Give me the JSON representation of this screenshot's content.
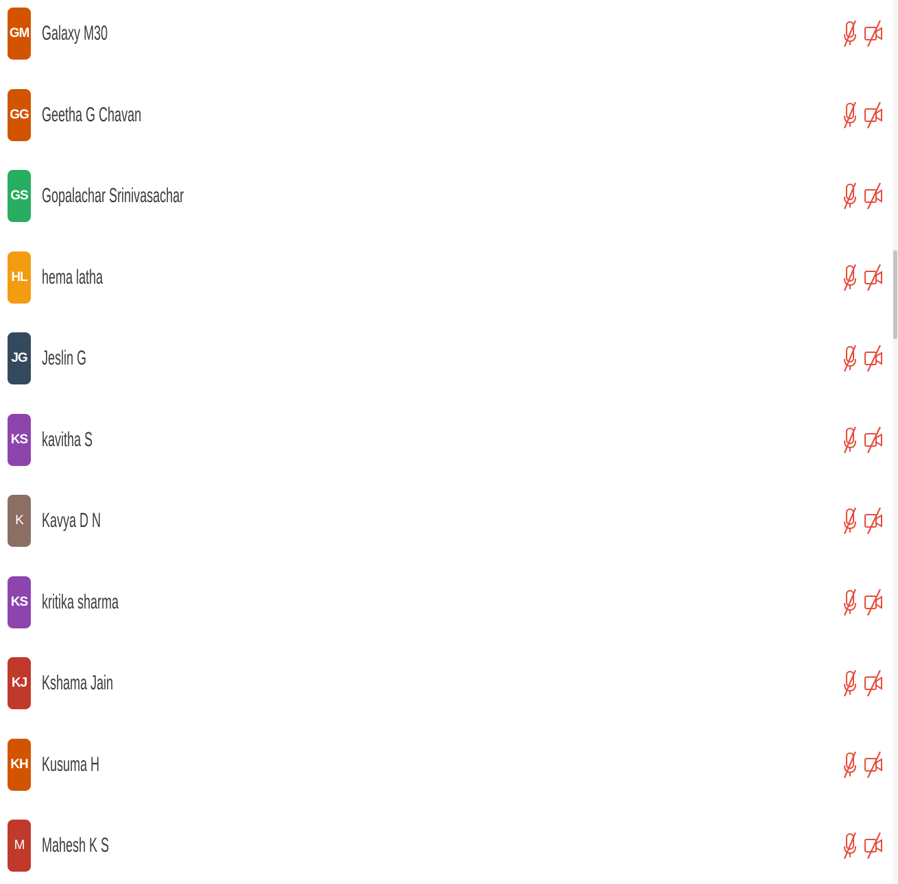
{
  "participants": [
    {
      "initials": "GM",
      "name": "Galaxy M30",
      "color": "#d35400",
      "mic": "muted",
      "camera": "off"
    },
    {
      "initials": "GG",
      "name": "Geetha G Chavan",
      "color": "#d35400",
      "mic": "muted",
      "camera": "off"
    },
    {
      "initials": "GS",
      "name": "Gopalachar Srinivasachar",
      "color": "#27ae60",
      "mic": "muted",
      "camera": "off"
    },
    {
      "initials": "HL",
      "name": "hema latha",
      "color": "#f39c12",
      "mic": "muted",
      "camera": "off"
    },
    {
      "initials": "JG",
      "name": "Jeslin G",
      "color": "#34495e",
      "mic": "muted",
      "camera": "off"
    },
    {
      "initials": "KS",
      "name": "kavitha S",
      "color": "#8e44ad",
      "mic": "muted",
      "camera": "off"
    },
    {
      "initials": "K",
      "name": "Kavya D N",
      "color": "#8d6e63",
      "mic": "muted",
      "camera": "off"
    },
    {
      "initials": "KS",
      "name": "kritika sharma",
      "color": "#8e44ad",
      "mic": "muted",
      "camera": "off"
    },
    {
      "initials": "KJ",
      "name": "Kshama Jain",
      "color": "#c0392b",
      "mic": "muted",
      "camera": "off"
    },
    {
      "initials": "KH",
      "name": "Kusuma H",
      "color": "#d35400",
      "mic": "muted",
      "camera": "off"
    },
    {
      "initials": "M",
      "name": "Mahesh K S",
      "color": "#c0392b",
      "mic": "muted",
      "camera": "off"
    }
  ],
  "icons": {
    "mic": "mic-off-icon",
    "camera": "camera-off-icon"
  },
  "theme": {
    "muted_icon_color": "#e74c3c"
  }
}
